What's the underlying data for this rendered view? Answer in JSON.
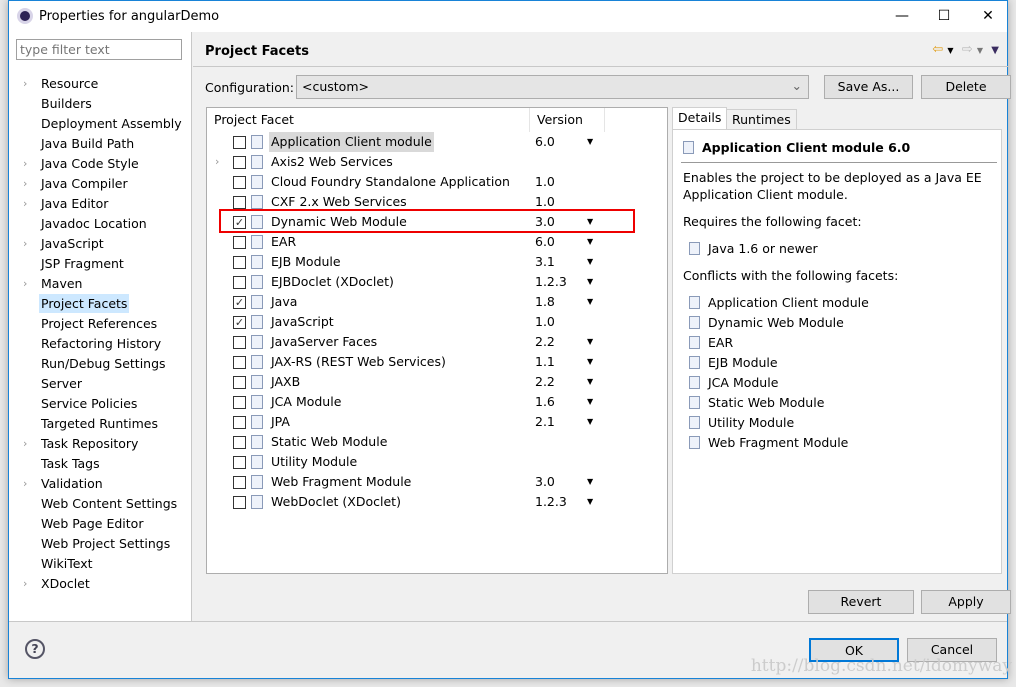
{
  "window": {
    "title": "Properties for angularDemo",
    "minimize": "—",
    "maximize": "☐",
    "close": "✕"
  },
  "sidebar": {
    "filter_placeholder": "type filter text",
    "selected": "Project Facets",
    "items": [
      {
        "label": "Resource",
        "expandable": true
      },
      {
        "label": "Builders"
      },
      {
        "label": "Deployment Assembly"
      },
      {
        "label": "Java Build Path"
      },
      {
        "label": "Java Code Style",
        "expandable": true
      },
      {
        "label": "Java Compiler",
        "expandable": true
      },
      {
        "label": "Java Editor",
        "expandable": true
      },
      {
        "label": "Javadoc Location"
      },
      {
        "label": "JavaScript",
        "expandable": true
      },
      {
        "label": "JSP Fragment"
      },
      {
        "label": "Maven",
        "expandable": true
      },
      {
        "label": "Project Facets"
      },
      {
        "label": "Project References"
      },
      {
        "label": "Refactoring History"
      },
      {
        "label": "Run/Debug Settings"
      },
      {
        "label": "Server"
      },
      {
        "label": "Service Policies"
      },
      {
        "label": "Targeted Runtimes"
      },
      {
        "label": "Task Repository",
        "expandable": true
      },
      {
        "label": "Task Tags"
      },
      {
        "label": "Validation",
        "expandable": true
      },
      {
        "label": "Web Content Settings"
      },
      {
        "label": "Web Page Editor"
      },
      {
        "label": "Web Project Settings"
      },
      {
        "label": "WikiText"
      },
      {
        "label": "XDoclet",
        "expandable": true
      }
    ]
  },
  "header": {
    "title": "Project Facets",
    "back_icon": "arrow-left",
    "forward_icon": "arrow-right",
    "menu_icon": "triangle-down"
  },
  "config": {
    "label": "Configuration:",
    "value": "<custom>",
    "save_as": "Save As...",
    "delete": "Delete"
  },
  "table": {
    "col_facet": "Project Facet",
    "col_version": "Version",
    "rows": [
      {
        "name": "Application Client module",
        "version": "6.0",
        "checked": false,
        "dropdown": true,
        "highlight": true
      },
      {
        "name": "Axis2 Web Services",
        "version": "",
        "checked": false,
        "expandable": true
      },
      {
        "name": "Cloud Foundry Standalone Application",
        "version": "1.0",
        "checked": false
      },
      {
        "name": "CXF 2.x Web Services",
        "version": "1.0",
        "checked": false
      },
      {
        "name": "Dynamic Web Module",
        "version": "3.0",
        "checked": true,
        "dropdown": true,
        "annotated": true
      },
      {
        "name": "EAR",
        "version": "6.0",
        "checked": false,
        "dropdown": true
      },
      {
        "name": "EJB Module",
        "version": "3.1",
        "checked": false,
        "dropdown": true
      },
      {
        "name": "EJBDoclet (XDoclet)",
        "version": "1.2.3",
        "checked": false,
        "dropdown": true
      },
      {
        "name": "Java",
        "version": "1.8",
        "checked": true,
        "dropdown": true
      },
      {
        "name": "JavaScript",
        "version": "1.0",
        "checked": true
      },
      {
        "name": "JavaServer Faces",
        "version": "2.2",
        "checked": false,
        "dropdown": true
      },
      {
        "name": "JAX-RS (REST Web Services)",
        "version": "1.1",
        "checked": false,
        "dropdown": true
      },
      {
        "name": "JAXB",
        "version": "2.2",
        "checked": false,
        "dropdown": true
      },
      {
        "name": "JCA Module",
        "version": "1.6",
        "checked": false,
        "dropdown": true
      },
      {
        "name": "JPA",
        "version": "2.1",
        "checked": false,
        "dropdown": true
      },
      {
        "name": "Static Web Module",
        "version": "",
        "checked": false
      },
      {
        "name": "Utility Module",
        "version": "",
        "checked": false
      },
      {
        "name": "Web Fragment Module",
        "version": "3.0",
        "checked": false,
        "dropdown": true
      },
      {
        "name": "WebDoclet (XDoclet)",
        "version": "1.2.3",
        "checked": false,
        "dropdown": true
      }
    ]
  },
  "details": {
    "tabs": [
      "Details",
      "Runtimes"
    ],
    "active_tab": "Details",
    "title": "Application Client module 6.0",
    "desc_line1": "Enables the project to be deployed as a Java EE",
    "desc_line2": "Application Client module.",
    "requires_label": "Requires the following facet:",
    "requires": [
      "Java 1.6 or newer"
    ],
    "conflicts_label": "Conflicts with the following facets:",
    "conflicts": [
      "Application Client module",
      "Dynamic Web Module",
      "EAR",
      "EJB Module",
      "JCA Module",
      "Static Web Module",
      "Utility Module",
      "Web Fragment Module"
    ]
  },
  "buttons": {
    "revert": "Revert",
    "apply": "Apply",
    "ok": "OK",
    "cancel": "Cancel",
    "help": "?"
  },
  "watermark": "http://blog.csdn.net/idomyway",
  "colors": {
    "selection": "#cde8ff",
    "annotation": "#e00000",
    "ok_border": "#0078d7"
  }
}
